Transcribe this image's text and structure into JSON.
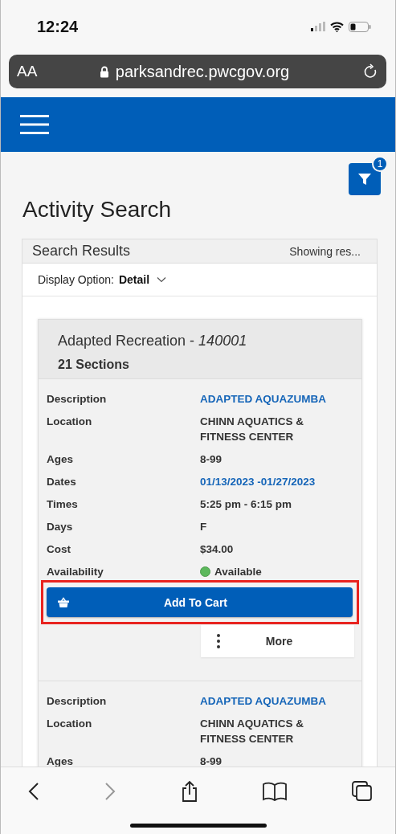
{
  "status_bar": {
    "time": "12:24"
  },
  "browser": {
    "text_size": "AA",
    "url": "parksandrec.pwcgov.org"
  },
  "filter": {
    "badge": "1"
  },
  "page_title": "Activity Search",
  "results": {
    "title": "Search Results",
    "summary": "Showing res...",
    "display_option": {
      "label": "Display Option:",
      "value": "Detail"
    }
  },
  "activity": {
    "title": "Adapted Recreation - *140001*",
    "sections_count": "21 Sections",
    "sections": [
      {
        "fields": [
          {
            "label": "Description",
            "value": "ADAPTED AQUAZUMBA",
            "kind": "link"
          },
          {
            "label": "Location",
            "value": "CHINN AQUATICS & FITNESS CENTER",
            "kind": "text"
          },
          {
            "label": "Ages",
            "value": "8-99",
            "kind": "text"
          },
          {
            "label": "Dates",
            "value": "01/13/2023 -01/27/2023",
            "kind": "link"
          },
          {
            "label": "Times",
            "value": "5:25 pm - 6:15 pm",
            "kind": "text"
          },
          {
            "label": "Days",
            "value": "F",
            "kind": "text"
          },
          {
            "label": "Cost",
            "value": "$34.00",
            "kind": "text"
          },
          {
            "label": "Availability",
            "value": "Available",
            "kind": "status",
            "color": "#5cb85c"
          }
        ],
        "add_button": {
          "label": "Add To Cart",
          "highlighted": true
        },
        "more_button": {
          "label": "More"
        }
      },
      {
        "fields": [
          {
            "label": "Description",
            "value": "ADAPTED AQUAZUMBA",
            "kind": "link"
          },
          {
            "label": "Location",
            "value": "CHINN AQUATICS & FITNESS CENTER",
            "kind": "text"
          },
          {
            "label": "Ages",
            "value": "8-99",
            "kind": "text"
          }
        ]
      }
    ]
  }
}
